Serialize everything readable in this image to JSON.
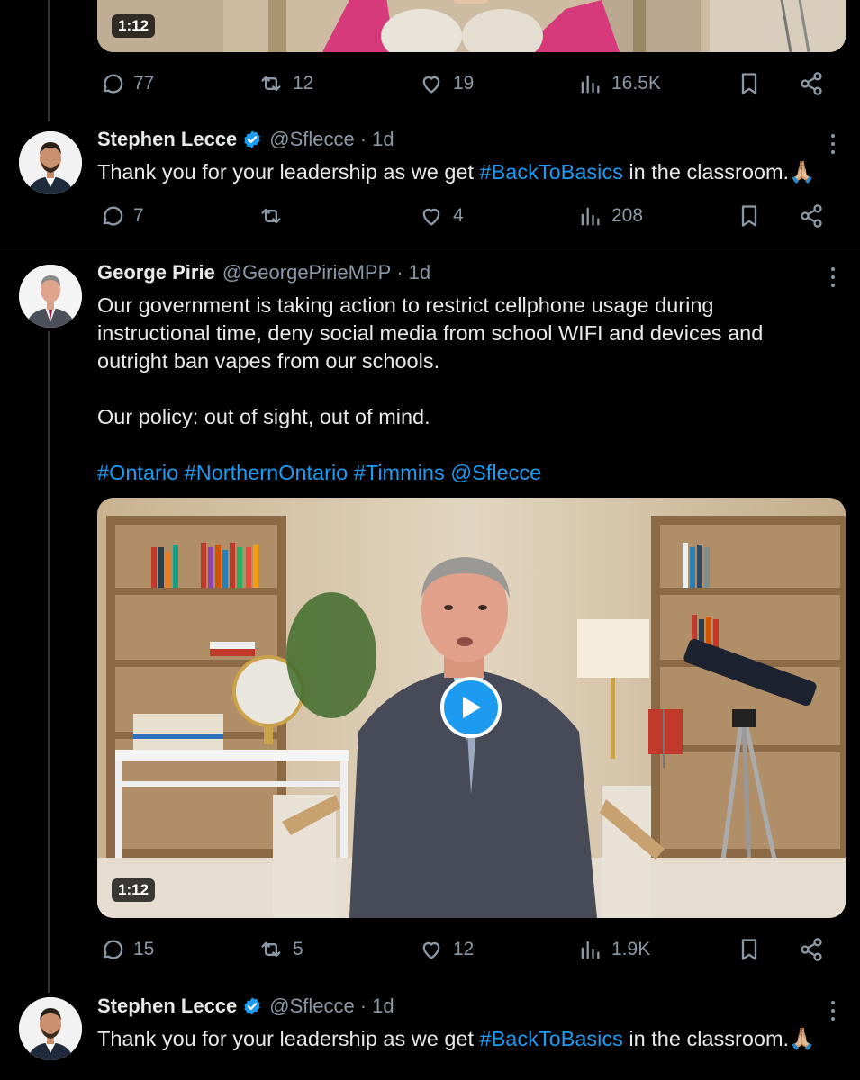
{
  "top_media": {
    "duration": "1:12"
  },
  "top_actions": {
    "replies": "77",
    "retweets": "12",
    "likes": "19",
    "views": "16.5K"
  },
  "tweets": [
    {
      "name": "Stephen Lecce",
      "handle": "@Sflecce",
      "dot": "·",
      "time": "1d",
      "text_before": "Thank you for your leadership as we get ",
      "hashtag": "#BackToBasics",
      "text_after": " in the classroom.🙏🏼",
      "actions": {
        "replies": "7",
        "retweets": "",
        "likes": "4",
        "views": "208"
      }
    },
    {
      "name": "George Pirie",
      "handle": "@GeorgePirieMPP",
      "dot": "·",
      "time": "1d",
      "paragraph1": "Our government is taking action to restrict cellphone usage during instructional time, deny social media from school WIFI and devices and outright ban vapes from our schools.",
      "paragraph2": "Our policy: out of sight, out of mind.",
      "tags": [
        "#Ontario",
        "#NorthernOntario",
        "#Timmins",
        "@Sflecce"
      ],
      "video_duration": "1:12",
      "actions": {
        "replies": "15",
        "retweets": "5",
        "likes": "12",
        "views": "1.9K"
      }
    },
    {
      "name": "Stephen Lecce",
      "handle": "@Sflecce",
      "dot": "·",
      "time": "1d",
      "text_before": "Thank you for your leadership as we get ",
      "hashtag": "#BackToBasics",
      "text_after": " in the classroom.🙏🏼"
    }
  ],
  "colors": {
    "background": "#000000",
    "link": "#1d9bf0",
    "muted": "#8b98a5",
    "verified": "#1d9bf0"
  }
}
